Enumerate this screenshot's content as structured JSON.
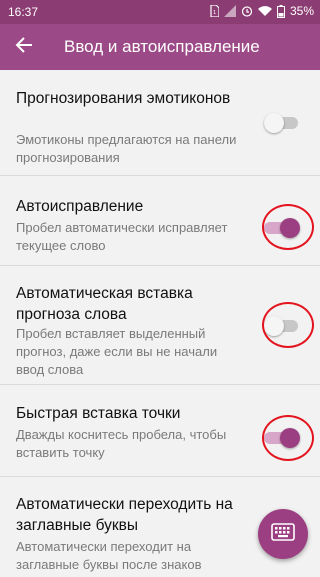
{
  "status_bar": {
    "time": "16:37",
    "battery": "35%",
    "icons": [
      "sim-icon",
      "signal-icon",
      "alarm-icon",
      "wifi-icon",
      "battery-icon"
    ]
  },
  "app_bar": {
    "title": "Ввод и автоисправление",
    "back_icon": "arrow-back-icon",
    "color": "#9c4a87"
  },
  "settings": [
    {
      "title": "Прогнозирования эмотиконов",
      "subtitle": "Эмотиконы предлагаются на панели прогнозирования",
      "enabled": false
    },
    {
      "title": "Автоисправление",
      "subtitle": "Пробел автоматически исправляет текущее слово",
      "enabled": true
    },
    {
      "title": "Автоматическая вставка прогноза слова",
      "subtitle": "Пробел вставляет выделенный прогноз, даже если вы не начали ввод слова",
      "enabled": false
    },
    {
      "title": "Быстрая вставка точки",
      "subtitle": "Дважды коснитесь пробела, чтобы вставить точку",
      "enabled": true
    },
    {
      "title": "Автоматически переходить на заглавные буквы",
      "subtitle": "Автоматически переходит на заглавные буквы после знаков"
    }
  ],
  "fab": {
    "icon": "keyboard-icon"
  },
  "colors": {
    "accent": "#9c3f82",
    "highlight": "#e3141e"
  }
}
